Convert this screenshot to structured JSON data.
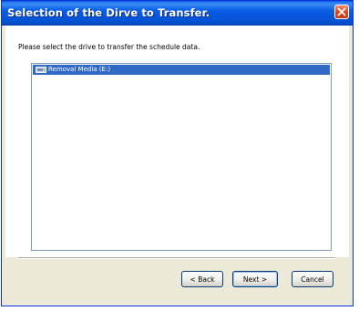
{
  "window": {
    "title": "Selection of the Dirve to Transfer."
  },
  "content": {
    "instruction": "Please select the drive to transfer the schedule data.",
    "drives": [
      {
        "label": "Removal Media (E:)",
        "icon": "drive-icon",
        "selected": true
      }
    ]
  },
  "footer": {
    "back_label": "< Back",
    "next_label": "Next >",
    "cancel_label": "Cancel"
  },
  "colors": {
    "titlebar": "#0a5ee6",
    "selection": "#316ac5",
    "close_button": "#d8461f",
    "dialog_face": "#ece9d8"
  }
}
